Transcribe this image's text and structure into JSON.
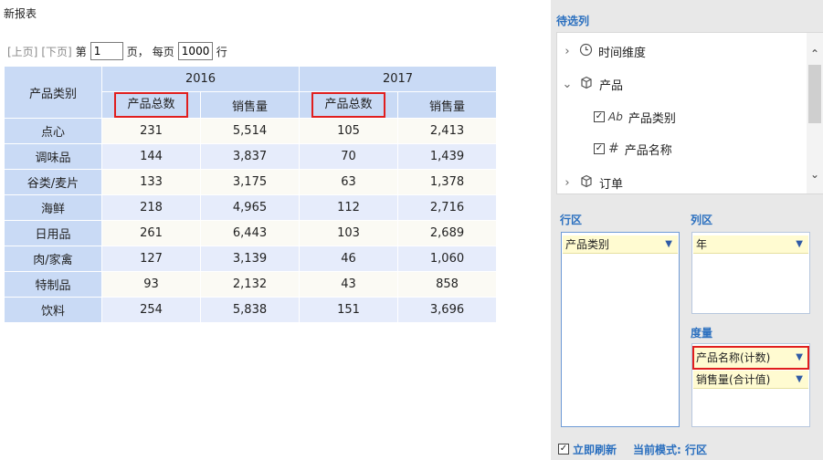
{
  "report": {
    "title": "新报表",
    "pager": {
      "prev": "[上页]",
      "next": "[下页]",
      "page_prefix": "第",
      "page_value": "1",
      "page_suffix": "页，",
      "per_prefix": "每页",
      "per_value": "1000",
      "per_suffix": "行"
    },
    "table": {
      "row_header": "产品类别",
      "years": [
        "2016",
        "2017"
      ],
      "measure_headers": [
        "产品总数",
        "销售量",
        "产品总数",
        "销售量"
      ],
      "rows": [
        {
          "category": "点心",
          "values": [
            "231",
            "5,514",
            "105",
            "2,413"
          ]
        },
        {
          "category": "调味品",
          "values": [
            "144",
            "3,837",
            "70",
            "1,439"
          ]
        },
        {
          "category": "谷类/麦片",
          "values": [
            "133",
            "3,175",
            "63",
            "1,378"
          ]
        },
        {
          "category": "海鲜",
          "values": [
            "218",
            "4,965",
            "112",
            "2,716"
          ]
        },
        {
          "category": "日用品",
          "values": [
            "261",
            "6,443",
            "103",
            "2,689"
          ]
        },
        {
          "category": "肉/家禽",
          "values": [
            "127",
            "3,139",
            "46",
            "1,060"
          ]
        },
        {
          "category": "特制品",
          "values": [
            "93",
            "2,132",
            "43",
            "858"
          ]
        },
        {
          "category": "饮料",
          "values": [
            "254",
            "5,838",
            "151",
            "3,696"
          ]
        }
      ]
    }
  },
  "panel": {
    "fields_title": "待选列",
    "tree": [
      {
        "label": "时间维度",
        "icon": "clock-dimension-icon"
      },
      {
        "label": "产品",
        "icon": "cube-icon"
      },
      {
        "label": "产品类别",
        "icon": "text-field-icon",
        "icon_text": "Ab"
      },
      {
        "label": "产品名称",
        "icon": "number-field-icon",
        "icon_text": "#"
      },
      {
        "label": "订单",
        "icon": "cube-icon"
      }
    ],
    "rows_title": "行区",
    "rows_items": [
      "产品类别"
    ],
    "cols_title": "列区",
    "cols_items": [
      "年"
    ],
    "measures_title": "度量",
    "measures_items": [
      "产品名称(计数)",
      "销售量(合计值)"
    ],
    "refresh_label": "立即刷新",
    "mode_label": "当前模式: 行区",
    "colors": {
      "accent": "#2a6fbf",
      "header_bg": "#c9daf5",
      "highlight": "#e01e1e",
      "chip_bg": "#fffbd1"
    }
  }
}
